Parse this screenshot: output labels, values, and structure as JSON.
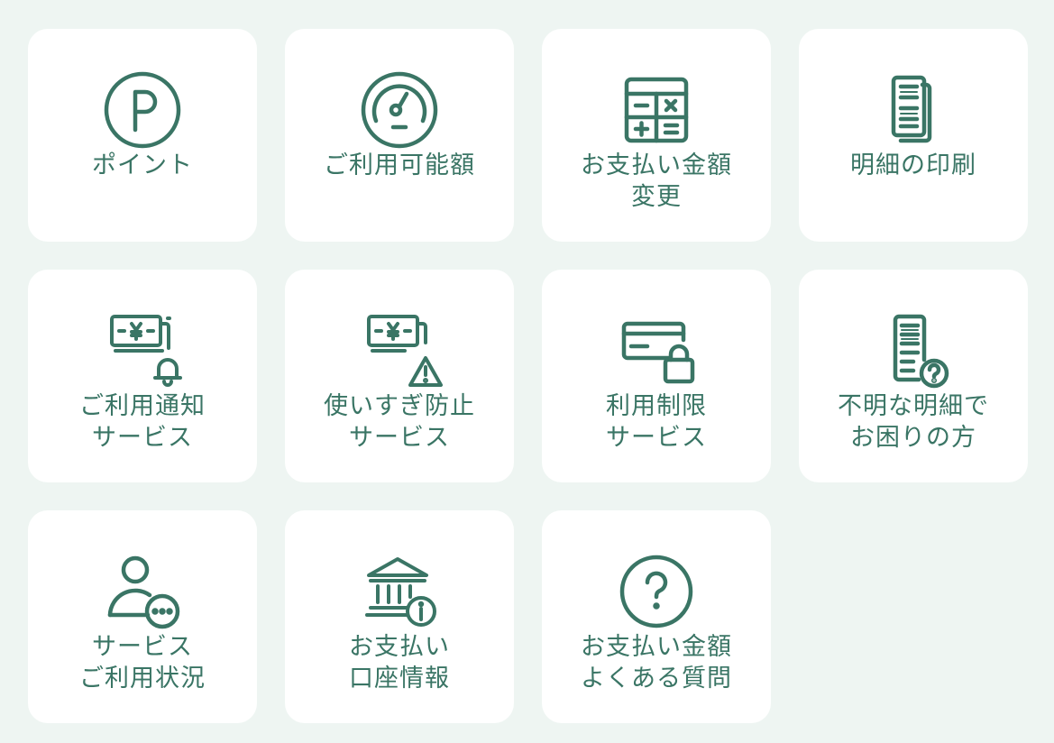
{
  "accent_color": "#3a7565",
  "background_color": "#eef5f2",
  "tiles": [
    {
      "icon": "point-icon",
      "lines": [
        "ポイント"
      ]
    },
    {
      "icon": "gauge-icon",
      "lines": [
        "ご利用可能額"
      ]
    },
    {
      "icon": "calculator-icon",
      "lines": [
        "お支払い金額",
        "変更"
      ]
    },
    {
      "icon": "statement-print-icon",
      "lines": [
        "明細の印刷"
      ]
    },
    {
      "icon": "yen-bill-bell-icon",
      "lines": [
        "ご利用通知",
        "サービス"
      ]
    },
    {
      "icon": "yen-bill-warning-icon",
      "lines": [
        "使いすぎ防止",
        "サービス"
      ]
    },
    {
      "icon": "card-lock-icon",
      "lines": [
        "利用制限",
        "サービス"
      ]
    },
    {
      "icon": "statement-question-icon",
      "lines": [
        "不明な明細で",
        "お困りの方"
      ]
    },
    {
      "icon": "user-more-icon",
      "lines": [
        "サービス",
        "ご利用状況"
      ]
    },
    {
      "icon": "bank-info-icon",
      "lines": [
        "お支払い",
        "口座情報"
      ]
    },
    {
      "icon": "question-circle-icon",
      "lines": [
        "お支払い金額",
        "よくある質問"
      ]
    }
  ]
}
